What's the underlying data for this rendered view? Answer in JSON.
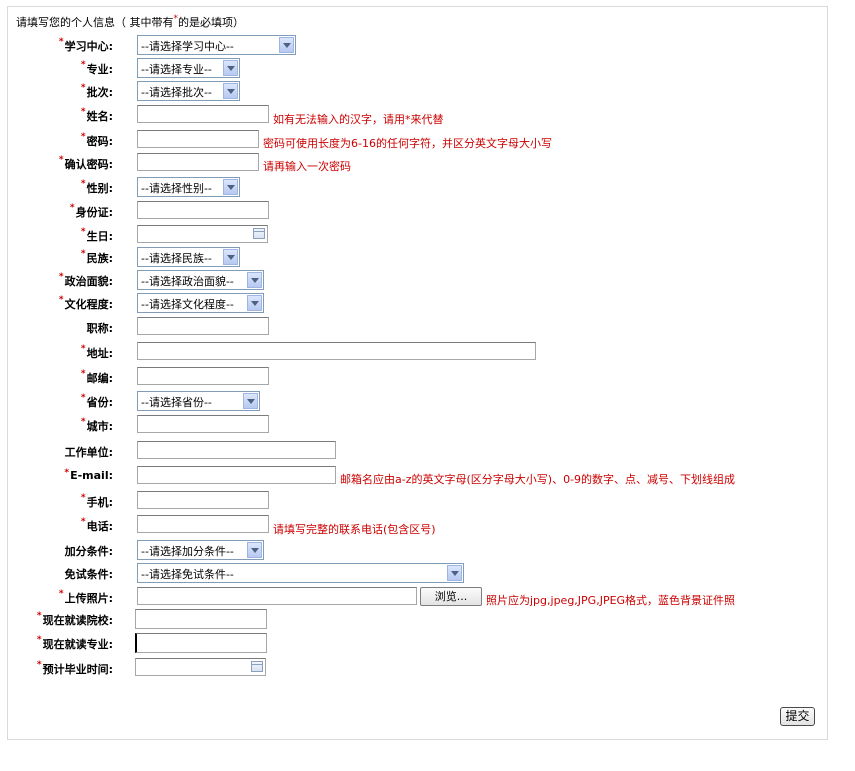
{
  "header": {
    "prefix": "请填写您的个人信息（ 其中带有",
    "asterisk": "*",
    "suffix": "的是必填项）"
  },
  "required_mark": "*",
  "fields": {
    "study_center": {
      "label": "学习中心:",
      "value": "--请选择学习中心--"
    },
    "major": {
      "label": "专业:",
      "value": "--请选择专业--"
    },
    "batch": {
      "label": "批次:",
      "value": "--请选择批次--"
    },
    "name": {
      "label": "姓名:",
      "value": "",
      "hint": "如有无法输入的汉字，请用*来代替"
    },
    "password": {
      "label": "密码:",
      "value": "",
      "hint": "密码可使用长度为6-16的任何字符，并区分英文字母大小写"
    },
    "confirm_password": {
      "label": "确认密码:",
      "value": "",
      "hint": "请再输入一次密码"
    },
    "gender": {
      "label": "性别:",
      "value": "--请选择性别--"
    },
    "id_card": {
      "label": "身份证:",
      "value": ""
    },
    "birthday": {
      "label": "生日:",
      "value": ""
    },
    "ethnicity": {
      "label": "民族:",
      "value": "--请选择民族--"
    },
    "political_status": {
      "label": "政治面貌:",
      "value": "--请选择政治面貌--"
    },
    "education": {
      "label": "文化程度:",
      "value": "--请选择文化程度--"
    },
    "title": {
      "label": "职称:",
      "value": ""
    },
    "address": {
      "label": "地址:",
      "value": ""
    },
    "postcode": {
      "label": "邮编:",
      "value": ""
    },
    "province": {
      "label": "省份:",
      "value": "--请选择省份--"
    },
    "city": {
      "label": "城市:",
      "value": ""
    },
    "employer": {
      "label": "工作单位:",
      "value": ""
    },
    "email": {
      "label": "E-mail:",
      "value": "",
      "hint": "邮箱名应由a-z的英文字母(区分字母大小写)、0-9的数字、点、减号、下划线组成"
    },
    "mobile": {
      "label": "手机:",
      "value": ""
    },
    "phone": {
      "label": "电话:",
      "value": "",
      "hint": "请填写完整的联系电话(包含区号)"
    },
    "bonus_condition": {
      "label": "加分条件:",
      "value": "--请选择加分条件--"
    },
    "exemption_condition": {
      "label": "免试条件:",
      "value": "--请选择免试条件--"
    },
    "photo": {
      "label": "上传照片:",
      "value": "",
      "browse_label": "浏览...",
      "hint": "照片应为jpg,jpeg,JPG,JPEG格式，蓝色背景证件照"
    },
    "current_school": {
      "label": "现在就读院校:",
      "value": ""
    },
    "current_major": {
      "label": "现在就读专业:",
      "value": ""
    },
    "graduation_time": {
      "label": "预计毕业时间:",
      "value": ""
    }
  },
  "submit_label": "提交"
}
